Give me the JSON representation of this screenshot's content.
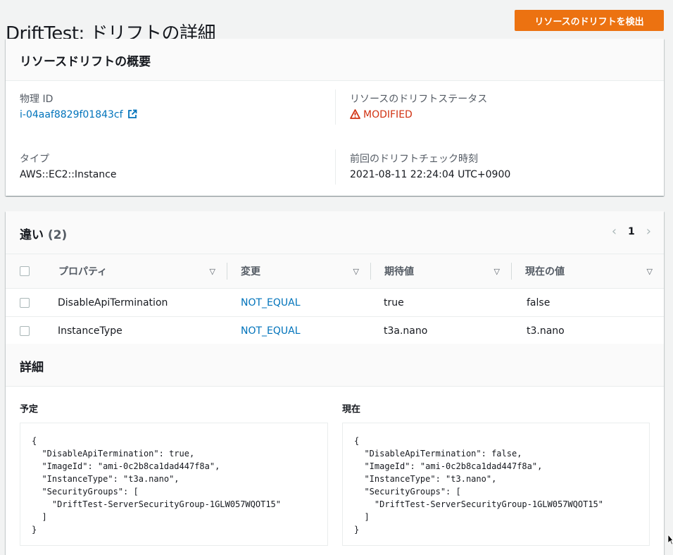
{
  "page": {
    "title": "DriftTest: ドリフトの詳細",
    "detect_button": "リソースのドリフトを検出"
  },
  "summary": {
    "heading": "リソースドリフトの概要",
    "physical_id_label": "物理 ID",
    "physical_id_value": "i-04aaf8829f01843cf",
    "drift_status_label": "リソースのドリフトステータス",
    "drift_status_value": "MODIFIED",
    "type_label": "タイプ",
    "type_value": "AWS::EC2::Instance",
    "last_check_label": "前回のドリフトチェック時刻",
    "last_check_value": "2021-08-11 22:24:04 UTC+0900"
  },
  "differences": {
    "heading": "違い",
    "count": "(2)",
    "page_number": "1",
    "columns": [
      "プロパティ",
      "変更",
      "期待値",
      "現在の値"
    ],
    "rows": [
      {
        "property": "DisableApiTermination",
        "change": "NOT_EQUAL",
        "expected": "true",
        "actual": "false"
      },
      {
        "property": "InstanceType",
        "change": "NOT_EQUAL",
        "expected": "t3a.nano",
        "actual": "t3.nano"
      }
    ]
  },
  "details": {
    "heading": "詳細",
    "expected_label": "予定",
    "current_label": "現在",
    "expected_json": "{\n  \"DisableApiTermination\": true,\n  \"ImageId\": \"ami-0c2b8ca1dad447f8a\",\n  \"InstanceType\": \"t3a.nano\",\n  \"SecurityGroups\": [\n    \"DriftTest-ServerSecurityGroup-1GLW057WQOT15\"\n  ]\n}",
    "current_json": "{\n  \"DisableApiTermination\": false,\n  \"ImageId\": \"ami-0c2b8ca1dad447f8a\",\n  \"InstanceType\": \"t3.nano\",\n  \"SecurityGroups\": [\n    \"DriftTest-ServerSecurityGroup-1GLW057WQOT15\"\n  ]\n}"
  },
  "colors": {
    "accent_orange": "#ec7211",
    "link_blue": "#0073bb",
    "status_red": "#d13212"
  },
  "icons": {
    "external_link": "external-link-icon",
    "warning": "warning-icon",
    "sort": "caret-down-icon",
    "prev": "chevron-left-icon",
    "next": "chevron-right-icon"
  }
}
